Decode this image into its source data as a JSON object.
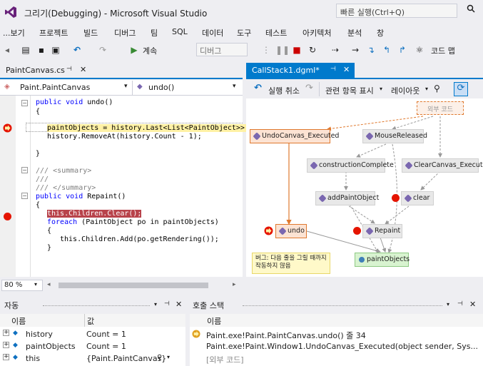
{
  "window": {
    "title": "그리기(Debugging) - Microsoft Visual Studio",
    "quick_launch_placeholder": "빠른 실행(Ctrl+Q)"
  },
  "menu": [
    "...보기",
    "프로젝트",
    "빌드",
    "디버그",
    "팀",
    "SQL",
    "데이터",
    "도구",
    "테스트",
    "아키텍처",
    "분석",
    "창"
  ],
  "toolbar": {
    "continue_label": "계속",
    "config_value": "디버그",
    "code_map_label": "코드 맵"
  },
  "editor": {
    "tab_label": "PaintCanvas.cs",
    "nav_class": "Paint.PaintCanvas",
    "nav_member": "undo()",
    "lines": [
      {
        "kw": "public void ",
        "rest": "undo()"
      },
      {
        "rest": "{"
      },
      {
        "rest": ""
      },
      {
        "rest": "paintObjects = history.Last<List<PaintObject>>();"
      },
      {
        "rest": "history.RemoveAt(history.Count - 1);"
      },
      {
        "rest": ""
      },
      {
        "rest": "}"
      },
      {
        "rest": ""
      },
      {
        "cm": "/// <summary>"
      },
      {
        "cm": "///"
      },
      {
        "cm": "/// </summary>"
      },
      {
        "kw": "public void ",
        "rest": "Repaint()"
      },
      {
        "rest": "{"
      },
      {
        "rest": "this.Children.Clear();"
      },
      {
        "kw": "foreach ",
        "rest": "(PaintObject po in paintObjects)"
      },
      {
        "rest": "{"
      },
      {
        "rest": "this.Children.Add(po.getRendering());"
      },
      {
        "rest": "}"
      }
    ],
    "zoom": "80 %"
  },
  "graph": {
    "tab_label": "CallStack1.dgml*",
    "undo_label": "실행 취소",
    "related_label": "관련 항목 표시",
    "layout_label": "레이아웃",
    "external_code": "외부 코드",
    "nodes": {
      "undo_canvas": "UndoCanvas_Executed",
      "mouse_released": "MouseReleased",
      "construction_complete": "constructionComplete",
      "clear_canvas": "ClearCanvas_Executed",
      "add_paint_object": "addPaintObject",
      "clear": "clear",
      "repaint": "Repaint",
      "undo": "undo",
      "paint_objects": "paintObjects"
    },
    "note": "버그: 다음 줄을 그릴 때까지 작동하지 않음"
  },
  "autos": {
    "title": "자동",
    "col_name": "이름",
    "col_value": "값",
    "rows": [
      {
        "name": "history",
        "value": "Count = 1"
      },
      {
        "name": "paintObjects",
        "value": "Count = 1"
      },
      {
        "name": "this",
        "value": "{Paint.PaintCanvas}"
      }
    ]
  },
  "callstack": {
    "title": "호출 스택",
    "col_name": "이름",
    "rows": [
      "Paint.exe!Paint.PaintCanvas.undo() 줄 34",
      "Paint.exe!Paint.Window1.UndoCanvas_Executed(object sender, Sys...",
      "[외부 코드]"
    ]
  },
  "colors": {
    "accent": "#007acc",
    "breakpoint": "#e51400",
    "current_line": "#fff1a5",
    "bp_line": "#b8434b"
  }
}
